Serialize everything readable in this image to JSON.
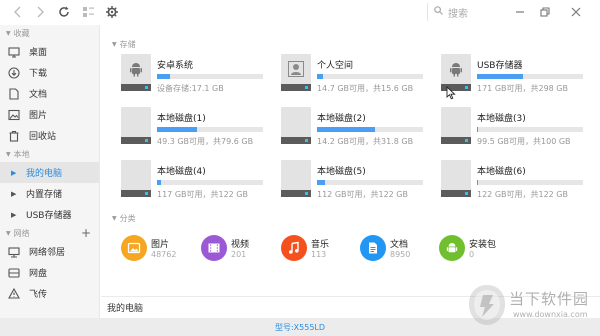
{
  "toolbar": {
    "search_placeholder": "搜索",
    "icons": [
      "chevron-left-icon",
      "chevron-right-icon",
      "refresh-icon",
      "list-view-icon",
      "gear-icon",
      "search-icon",
      "minimize-icon",
      "restore-icon",
      "close-icon"
    ]
  },
  "sidebar": {
    "favorites_title": "收藏",
    "favorites": [
      {
        "label": "桌面",
        "icon": "desktop-icon"
      },
      {
        "label": "下载",
        "icon": "download-icon"
      },
      {
        "label": "文档",
        "icon": "document-icon"
      },
      {
        "label": "图片",
        "icon": "picture-icon"
      },
      {
        "label": "回收站",
        "icon": "trash-icon"
      }
    ],
    "local_title": "本地",
    "local": [
      {
        "label": "我的电脑",
        "selected": true
      },
      {
        "label": "内置存储",
        "selected": false
      },
      {
        "label": "USB存储器",
        "selected": false
      }
    ],
    "network_title": "网络",
    "network": [
      {
        "label": "网络邻居",
        "icon": "network-neighborhood-icon"
      },
      {
        "label": "网盘",
        "icon": "cloud-drive-icon"
      },
      {
        "label": "飞传",
        "icon": "transfer-icon"
      }
    ]
  },
  "main": {
    "storage_title": "存储",
    "drives": [
      {
        "name": "安卓系统",
        "info": "设备存储:17.1 GB",
        "fill": 0.12,
        "symbol": "android"
      },
      {
        "name": "个人空间",
        "info": "14.7 GB可用，共15.6 GB",
        "fill": 0.06,
        "symbol": "person"
      },
      {
        "name": "USB存储器",
        "info": "171 GB可用，共298 GB",
        "fill": 0.43,
        "symbol": "android"
      },
      {
        "name": "本地磁盘(1)",
        "info": "49.3 GB可用，共79.6 GB",
        "fill": 0.38,
        "symbol": "none"
      },
      {
        "name": "本地磁盘(2)",
        "info": "14.2 GB可用，共31.8 GB",
        "fill": 0.55,
        "symbol": "none"
      },
      {
        "name": "本地磁盘(3)",
        "info": "99.5 GB可用，共100 GB",
        "fill": 0.01,
        "symbol": "none"
      },
      {
        "name": "本地磁盘(4)",
        "info": "117 GB可用，共122 GB",
        "fill": 0.04,
        "symbol": "none"
      },
      {
        "name": "本地磁盘(5)",
        "info": "112 GB可用，共122 GB",
        "fill": 0.08,
        "symbol": "none"
      },
      {
        "name": "本地磁盘(6)",
        "info": "122 GB可用，共122 GB",
        "fill": 0.01,
        "symbol": "none"
      }
    ],
    "category_title": "分类",
    "categories": [
      {
        "name": "图片",
        "count": "48762",
        "color": "#f5a623",
        "icon": "picture-icon"
      },
      {
        "name": "视频",
        "count": "201",
        "color": "#9b59d6",
        "icon": "film-icon"
      },
      {
        "name": "音乐",
        "count": "113",
        "color": "#f4511e",
        "icon": "music-icon"
      },
      {
        "name": "文档",
        "count": "8950",
        "color": "#2196f3",
        "icon": "document-icon"
      },
      {
        "name": "安装包",
        "count": "0",
        "color": "#6fbf2f",
        "icon": "android-icon"
      }
    ]
  },
  "pathbar": {
    "path": "我的电脑"
  },
  "status": {
    "model": "型号:X555LD"
  },
  "watermark": {
    "title": "当下软件园",
    "url": "www.downxia.com"
  }
}
